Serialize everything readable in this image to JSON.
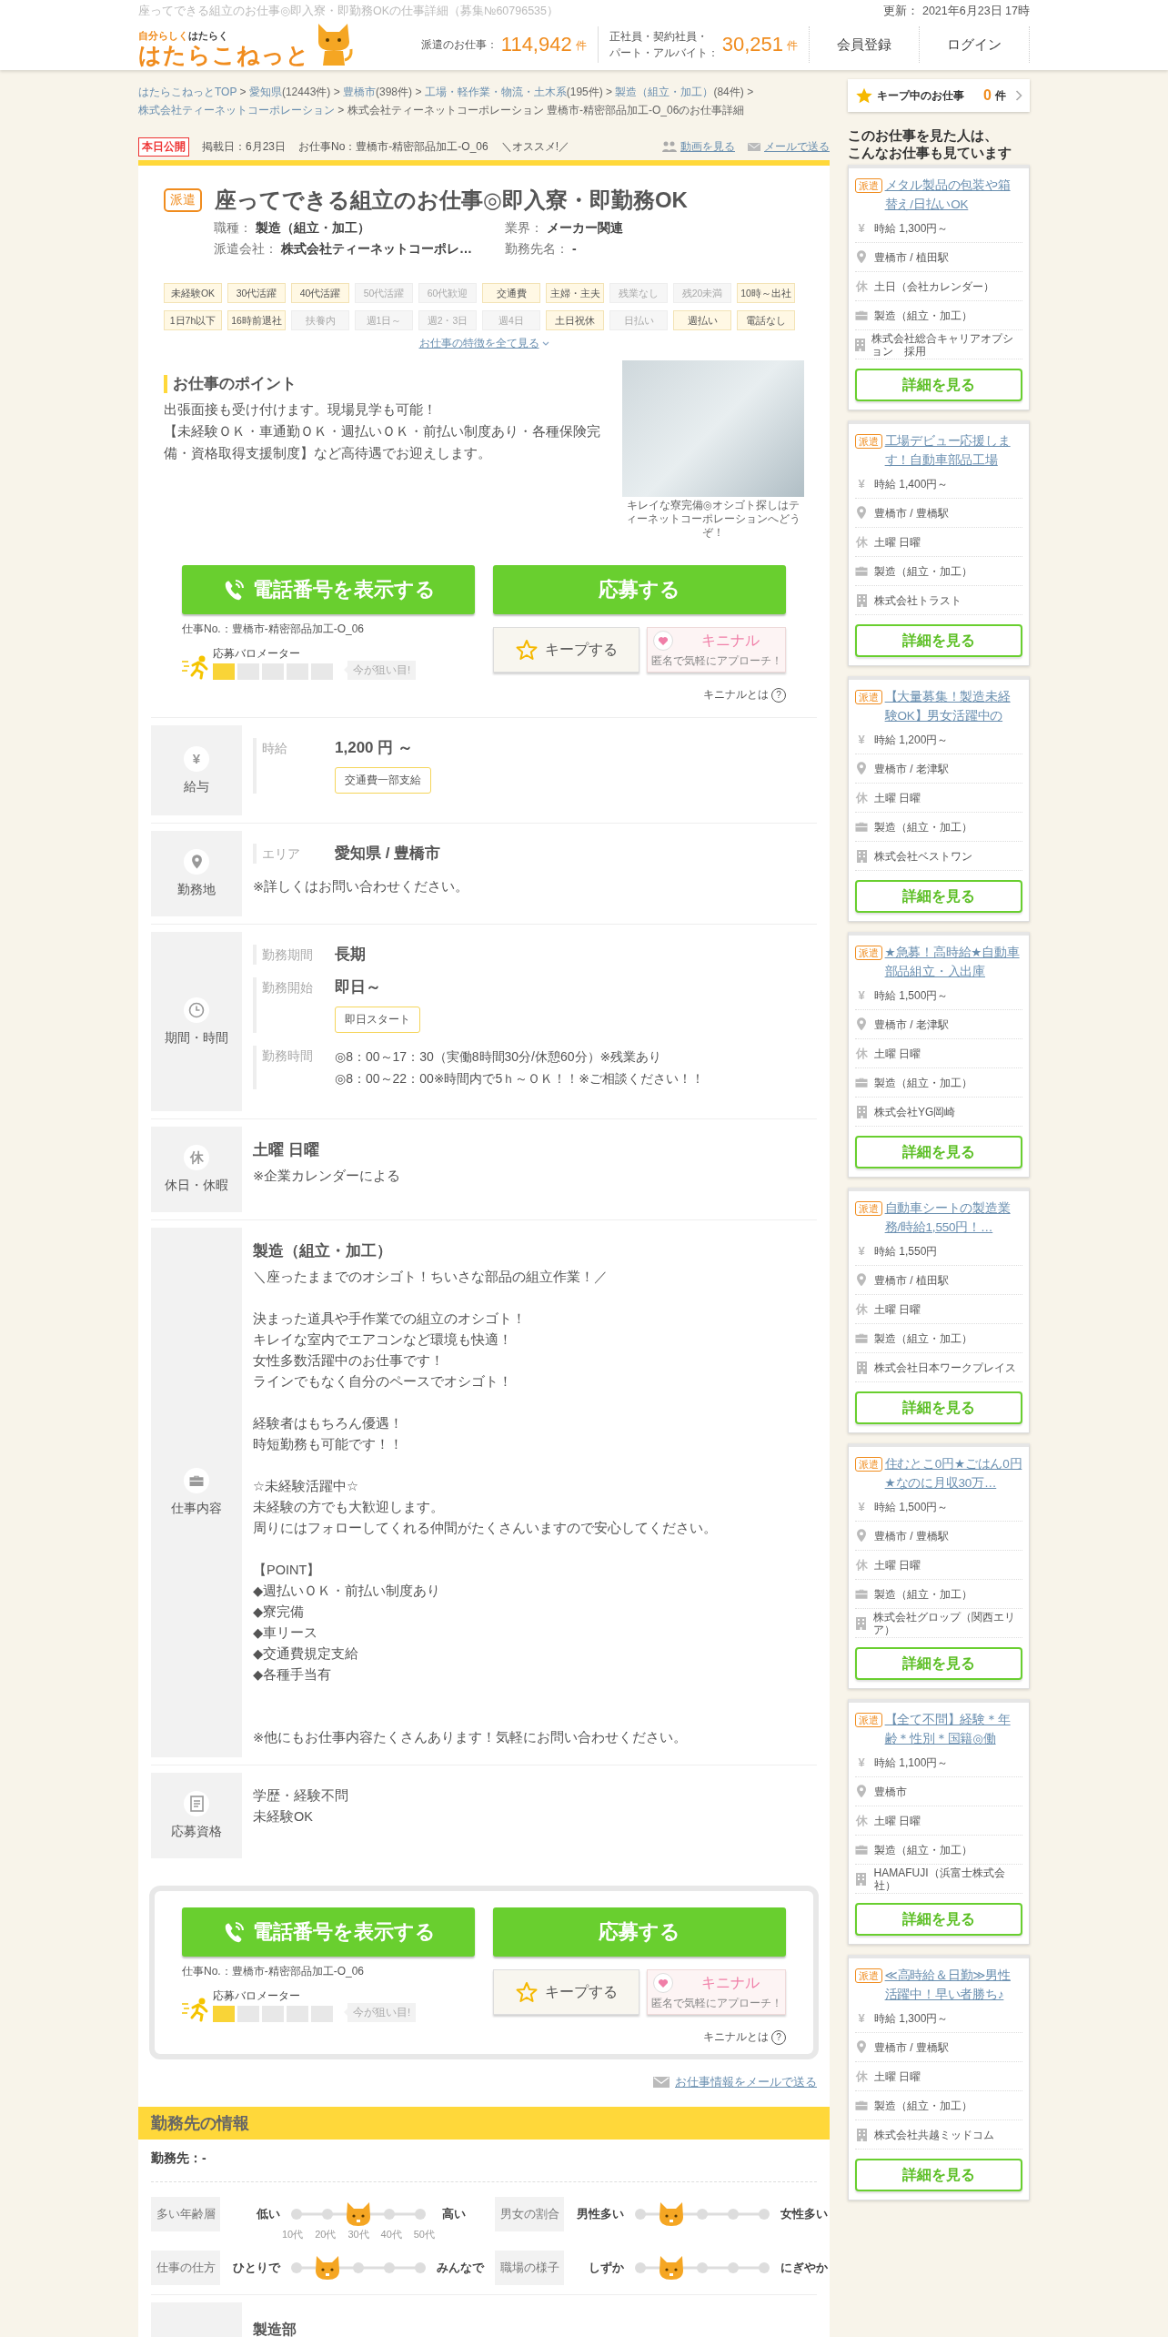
{
  "header": {
    "page_title": "座ってできる組立のお仕事◎即入寮・即勤務OKの仕事詳細（募集№60796535）",
    "updated": "更新： 2021年6月23日 17時",
    "tagline_1": "自分らしく",
    "tagline_2": "はたらく",
    "logo": "はたらこねっと",
    "stats": [
      {
        "label_lines": [
          "派遣のお仕事："
        ],
        "count": "114,942",
        "unit": "件"
      },
      {
        "label_lines": [
          "正社員・契約社員・",
          "パート・アルバイト："
        ],
        "count": "30,251",
        "unit": "件"
      }
    ],
    "nav": [
      "会員登録",
      "ログイン"
    ]
  },
  "breadcrumb": [
    {
      "kind": "link",
      "label": "はたらこねっとTOP"
    },
    {
      "kind": "link",
      "sep": ">",
      "label": "愛知県",
      "count": "(12443件)"
    },
    {
      "kind": "link",
      "sep": ">",
      "label": "豊橋市",
      "count": "(398件)"
    },
    {
      "kind": "link",
      "sep": ">",
      "label": "工場・軽作業・物流・土木系",
      "count": "(195件)"
    },
    {
      "kind": "link",
      "sep": ">",
      "label": "製造（組立・加工）",
      "count": "(84件)"
    },
    {
      "kind": "link",
      "sep": ">",
      "label": "株式会社ティーネットコーポレーション"
    },
    {
      "kind": "current",
      "sep": ">",
      "label": "株式会社ティーネットコーポレーション 豊橋市-精密部品加工-O_06のお仕事詳細"
    }
  ],
  "meta": {
    "badge": "本日公開",
    "posted": "掲載日：6月23日",
    "job_no": "お仕事No：豊橋市-精密部品加工-O_06",
    "recommend": "＼オススメ!／",
    "video_link": "動画を見る",
    "mail_link": "メールで送る"
  },
  "job": {
    "type_badge": "派遣",
    "title": "座ってできる組立のお仕事◎即入寮・即勤務OK",
    "details": [
      {
        "label": "職種：",
        "value": "製造（組立・加工）"
      },
      {
        "label": "業界：",
        "value": "メーカー関連"
      },
      {
        "label": "派遣会社：",
        "value": "株式会社ティーネットコーポレ…"
      },
      {
        "label": "勤務先名：",
        "value": "-"
      }
    ],
    "features": [
      {
        "label": "未経験OK",
        "on": true
      },
      {
        "label": "30代活躍",
        "on": true
      },
      {
        "label": "40代活躍",
        "on": true
      },
      {
        "label": "50代活躍",
        "on": false
      },
      {
        "label": "60代歓迎",
        "on": false
      },
      {
        "label": "交通費",
        "on": true
      },
      {
        "label": "主婦・主夫",
        "on": true
      },
      {
        "label": "残業なし",
        "on": false
      },
      {
        "label": "残20未満",
        "on": false
      },
      {
        "label": "10時～出社",
        "on": true
      },
      {
        "label": "1日7h以下",
        "on": true
      },
      {
        "label": "16時前退社",
        "on": true
      },
      {
        "label": "扶養内",
        "on": false
      },
      {
        "label": "週1日～",
        "on": false
      },
      {
        "label": "週2・3日",
        "on": false
      },
      {
        "label": "週4日",
        "on": false
      },
      {
        "label": "土日祝休",
        "on": true
      },
      {
        "label": "日払い",
        "on": false
      },
      {
        "label": "週払い",
        "on": true
      },
      {
        "label": "電話なし",
        "on": true
      }
    ],
    "features_link": "お仕事の特徴を全て見る",
    "points_heading": "お仕事のポイント",
    "points_text": [
      "出張面接も受け付けます。現場見学も可能！",
      "【未経験ＯＫ・車通勤ＯＫ・週払いＯＫ・前払い制度あり・各種保険完備・資格取得支援制度】など高待遇でお迎えします。"
    ],
    "photo_caption": "キレイな寮完備◎オシゴト探しはティーネットコーポレーションへどうぞ！"
  },
  "actions": [
    {
      "phone_button": "電話番号を表示する",
      "apply_button": "応募する",
      "job_no": "仕事No.：豊橋市-精密部品加工-O_06",
      "barometer": {
        "label": "応募バロメーター",
        "level": 0.2,
        "hint": "今が狙い目!"
      },
      "keep_button": "キープする",
      "kininaru_title": "キニナル",
      "kininaru_sub": "匿名で気軽にアプローチ！",
      "about": "キニナルとは",
      "help_icon": "?"
    },
    {
      "phone_button": "電話番号を表示する",
      "apply_button": "応募する",
      "job_no": "仕事No.：豊橋市-精密部品加工-O_06",
      "barometer": {
        "label": "応募バロメーター",
        "level": 0.2,
        "hint": "今が狙い目!"
      },
      "keep_button": "キープする",
      "kininaru_title": "キニナル",
      "kininaru_sub": "匿名で気軽にアプローチ！",
      "about": "キニナルとは",
      "help_icon": "?"
    }
  ],
  "sections": [
    {
      "kind": "salary",
      "icon_glyph": "¥",
      "label": "給与",
      "rows": [
        {
          "label": "時給",
          "value": "1,200 円 ～",
          "tags": [
            "交通費一部支給"
          ]
        }
      ]
    },
    {
      "kind": "location",
      "label": "勤務地",
      "rows": [
        {
          "label": "エリア",
          "value": "愛知県 / 豊橋市"
        }
      ],
      "note": "※詳しくはお問い合わせください。"
    },
    {
      "kind": "period",
      "label": "期間・時間",
      "rows": [
        {
          "label": "勤務期間",
          "value": "長期"
        },
        {
          "label": "勤務開始",
          "value": "即日～",
          "tags": [
            "即日スタート"
          ]
        },
        {
          "label": "勤務時間",
          "lines": [
            "◎8：00～17：30（実働8時間30分/休憩60分）※残業あり",
            "◎8：00～22：00※時間内で5ｈ～ＯＫ！！※ご相談ください！！"
          ]
        }
      ]
    },
    {
      "kind": "holiday",
      "icon_glyph": "休",
      "label": "休日・休暇",
      "heading": "土曜 日曜",
      "note": "※企業カレンダーによる"
    },
    {
      "kind": "content",
      "label": "仕事内容",
      "heading": "製造（組立・加工）",
      "paragraphs": [
        [
          "＼座ったままでのオシゴト！ちいさな部品の組立作業！／"
        ],
        [
          "決まった道具や手作業での組立のオシゴト！",
          "キレイな室内でエアコンなど環境も快適！",
          "女性多数活躍中のお仕事です！",
          "ラインでもなく自分のペースでオシゴト！"
        ],
        [
          "経験者はもちろん優遇！",
          "時短勤務も可能です！！"
        ],
        [
          "☆未経験活躍中☆",
          "未経験の方でも大歓迎します。",
          "周りにはフォローしてくれる仲間がたくさんいますので安心してください。"
        ],
        [
          "【POINT】",
          "◆週払いＯＫ・前払い制度あり",
          "◆寮完備",
          "◆車リース",
          "◆交通費規定支給",
          "◆各種手当有"
        ],
        [
          "※他にもお仕事内容たくさんあります！気軽にお問い合わせください。"
        ]
      ]
    },
    {
      "kind": "qualification",
      "label": "応募資格",
      "paragraphs": [
        [
          "学歴・経験不問",
          "未経験OK"
        ]
      ]
    }
  ],
  "send_mail_link": "お仕事情報をメールで送る",
  "company": {
    "heading": "勤務先の情報",
    "name": "勤務先：-",
    "scales": [
      {
        "label": "多い年齢層",
        "low": "低い",
        "high": "高い",
        "ticks": [
          "10代",
          "20代",
          "30代",
          "40代",
          "50代"
        ],
        "level": 0.5
      },
      {
        "label": "男女の割合",
        "low": "男性多い",
        "high": "女性多い",
        "level": 0.25
      },
      {
        "label": "仕事の仕方",
        "low": "ひとりで",
        "high": "みんなで",
        "level": 0.25
      },
      {
        "label": "職場の様子",
        "low": "しずか",
        "high": "にぎやか",
        "level": 0.25
      }
    ],
    "department": "製造部"
  },
  "sidebar": {
    "keep_label": "キープ中のお仕事",
    "keep_count": "0",
    "keep_unit": "件",
    "heading": [
      "このお仕事を見た人は、",
      "こんなお仕事も見ています"
    ],
    "cards": [
      {
        "badge": "派遣",
        "title": "メタル製品の包装や箱替え/日払いOK",
        "rows": [
          {
            "kind": "wage",
            "glyph": "¥",
            "text": "時給 1,300円～"
          },
          {
            "kind": "station",
            "text": "豊橋市 / 植田駅"
          },
          {
            "kind": "holiday",
            "glyph": "休",
            "text": "土日（会社カレンダー）"
          },
          {
            "kind": "job",
            "text": "製造（組立・加工）"
          },
          {
            "kind": "company",
            "text": "株式会社総合キャリアオプション　採用"
          }
        ],
        "button": "詳細を見る"
      },
      {
        "badge": "派遣",
        "title": "工場デビュー応援します！自動車部品工場",
        "rows": [
          {
            "kind": "wage",
            "glyph": "¥",
            "text": "時給 1,400円～"
          },
          {
            "kind": "station",
            "text": "豊橋市 / 豊橋駅"
          },
          {
            "kind": "holiday",
            "glyph": "休",
            "text": "土曜 日曜"
          },
          {
            "kind": "job",
            "text": "製造（組立・加工）"
          },
          {
            "kind": "company",
            "text": "株式会社トラスト"
          }
        ],
        "button": "詳細を見る"
      },
      {
        "badge": "派遣",
        "title": "【大量募集！製造未経験OK】男女活躍中の",
        "rows": [
          {
            "kind": "wage",
            "glyph": "¥",
            "text": "時給 1,200円～"
          },
          {
            "kind": "station",
            "text": "豊橋市 / 老津駅"
          },
          {
            "kind": "holiday",
            "glyph": "休",
            "text": "土曜 日曜"
          },
          {
            "kind": "job",
            "text": "製造（組立・加工）"
          },
          {
            "kind": "company",
            "text": "株式会社ベストワン"
          }
        ],
        "button": "詳細を見る"
      },
      {
        "badge": "派遣",
        "title": "★急募！高時給★自動車部品組立・入出庫",
        "rows": [
          {
            "kind": "wage",
            "glyph": "¥",
            "text": "時給 1,500円～"
          },
          {
            "kind": "station",
            "text": "豊橋市 / 老津駅"
          },
          {
            "kind": "holiday",
            "glyph": "休",
            "text": "土曜 日曜"
          },
          {
            "kind": "job",
            "text": "製造（組立・加工）"
          },
          {
            "kind": "company",
            "text": "株式会社YG岡崎"
          }
        ],
        "button": "詳細を見る"
      },
      {
        "badge": "派遣",
        "title": "自動車シートの製造業務/時給1,550円！…",
        "rows": [
          {
            "kind": "wage",
            "glyph": "¥",
            "text": "時給 1,550円"
          },
          {
            "kind": "station",
            "text": "豊橋市 / 植田駅"
          },
          {
            "kind": "holiday",
            "glyph": "休",
            "text": "土曜 日曜"
          },
          {
            "kind": "job",
            "text": "製造（組立・加工）"
          },
          {
            "kind": "company",
            "text": "株式会社日本ワークプレイス"
          }
        ],
        "button": "詳細を見る"
      },
      {
        "badge": "派遣",
        "title": "住むとこ0円★ごはん0円★なのに月収30万…",
        "rows": [
          {
            "kind": "wage",
            "glyph": "¥",
            "text": "時給 1,500円～"
          },
          {
            "kind": "station",
            "text": "豊橋市 / 豊橋駅"
          },
          {
            "kind": "holiday",
            "glyph": "休",
            "text": "土曜 日曜"
          },
          {
            "kind": "job",
            "text": "製造（組立・加工）"
          },
          {
            "kind": "company",
            "text": "株式会社グロップ（関西エリア）"
          }
        ],
        "button": "詳細を見る"
      },
      {
        "badge": "派遣",
        "title": "【全て不問】経験＊年齢＊性別＊国籍◎働",
        "rows": [
          {
            "kind": "wage",
            "glyph": "¥",
            "text": "時給 1,100円～"
          },
          {
            "kind": "station",
            "text": "豊橋市"
          },
          {
            "kind": "holiday",
            "glyph": "休",
            "text": "土曜 日曜"
          },
          {
            "kind": "job",
            "text": "製造（組立・加工）"
          },
          {
            "kind": "company",
            "text": "HAMAFUJI（浜富士株式会社）"
          }
        ],
        "button": "詳細を見る"
      },
      {
        "badge": "派遣",
        "title": "≪高時給＆日勤≫男性活躍中！早い者勝ち♪",
        "rows": [
          {
            "kind": "wage",
            "glyph": "¥",
            "text": "時給 1,300円～"
          },
          {
            "kind": "station",
            "text": "豊橋市 / 豊橋駅"
          },
          {
            "kind": "holiday",
            "glyph": "休",
            "text": "土曜 日曜"
          },
          {
            "kind": "job",
            "text": "製造（組立・加工）"
          },
          {
            "kind": "company",
            "text": "株式会社共越ミッドコム"
          }
        ],
        "button": "詳細を見る"
      }
    ]
  }
}
